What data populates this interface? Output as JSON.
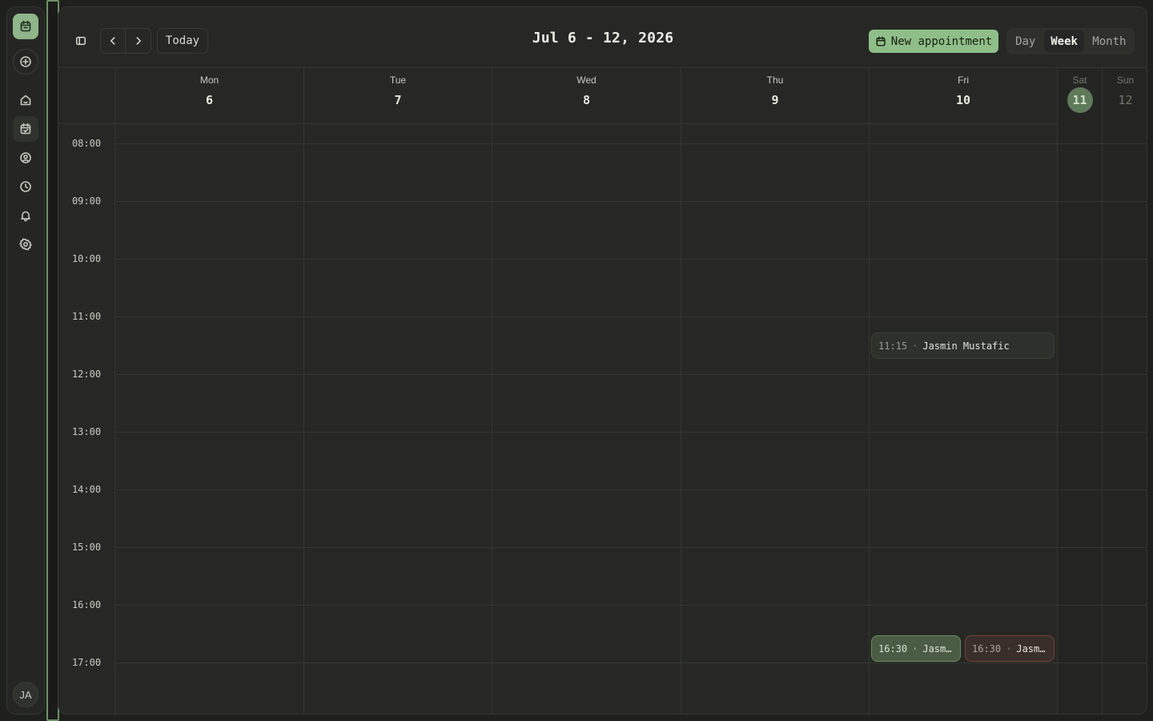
{
  "rail": {
    "brand_icon": "calendar-app-icon",
    "items": [
      {
        "name": "compass-icon"
      },
      {
        "name": "home-icon"
      },
      {
        "name": "calendar-check-icon"
      },
      {
        "name": "user-icon"
      },
      {
        "name": "clock-icon"
      },
      {
        "name": "bell-icon"
      },
      {
        "name": "settings-icon"
      }
    ],
    "avatar_initials": "JA"
  },
  "toolbar": {
    "today_label": "Today",
    "range_title": "Jul 6 - 12, 2026",
    "new_appointment_label": "New appointment",
    "views": {
      "day": "Day",
      "week": "Week",
      "month": "Month"
    },
    "active_view": "Week"
  },
  "days": [
    {
      "name": "Mon",
      "date": "6"
    },
    {
      "name": "Tue",
      "date": "7"
    },
    {
      "name": "Wed",
      "date": "8"
    },
    {
      "name": "Thu",
      "date": "9"
    },
    {
      "name": "Fri",
      "date": "10"
    },
    {
      "name": "Sat",
      "date": "11"
    },
    {
      "name": "Sun",
      "date": "12"
    }
  ],
  "hours": [
    "08:00",
    "09:00",
    "10:00",
    "11:00",
    "12:00",
    "13:00",
    "14:00",
    "15:00",
    "16:00",
    "17:00"
  ],
  "events": [
    {
      "time": "11:15",
      "separator": "·",
      "title": "Jasmin Mustafic",
      "day": "Fri",
      "color": "#2e302b"
    },
    {
      "time": "16:30",
      "separator": "·",
      "title": "Jasmi…",
      "day": "Fri",
      "color": "#4b5c45"
    },
    {
      "time": "16:30",
      "separator": "·",
      "title": "Jasmi…",
      "day": "Fri",
      "color": "#3a2e2a"
    }
  ],
  "colors": {
    "accent": "#8fbe89",
    "today_badge": "#5f7a5a",
    "background": "#272825"
  }
}
